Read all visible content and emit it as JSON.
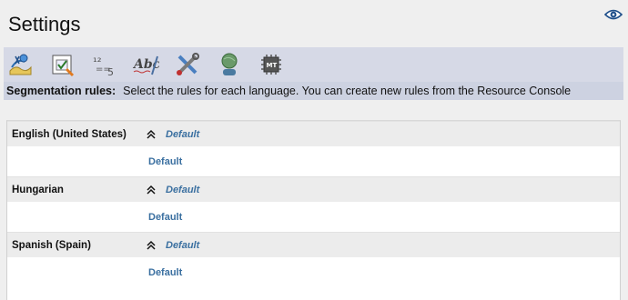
{
  "header": {
    "title": "Settings",
    "view_icon": "eye-icon"
  },
  "toolbar": {
    "buttons": [
      {
        "icon": "language-map-icon"
      },
      {
        "icon": "checklist-icon"
      },
      {
        "icon": "numbering-icon"
      },
      {
        "icon": "spellcheck-icon"
      },
      {
        "icon": "tools-icon"
      },
      {
        "icon": "globe-person-icon"
      },
      {
        "icon": "mt-chip-icon"
      }
    ]
  },
  "rules_bar": {
    "label": "Segmentation rules:",
    "description": "Select the rules for each language. You can create new rules from the Resource Console"
  },
  "languages": [
    {
      "name": "English (United States)",
      "selected": "Default",
      "option": "Default"
    },
    {
      "name": "Hungarian",
      "selected": "Default",
      "option": "Default"
    },
    {
      "name": "Spanish (Spain)",
      "selected": "Default",
      "option": "Default"
    }
  ],
  "colors": {
    "link": "#3a6fa0",
    "toolbar_bg": "#d6d9e6",
    "rules_bg": "#cdd2e1"
  }
}
